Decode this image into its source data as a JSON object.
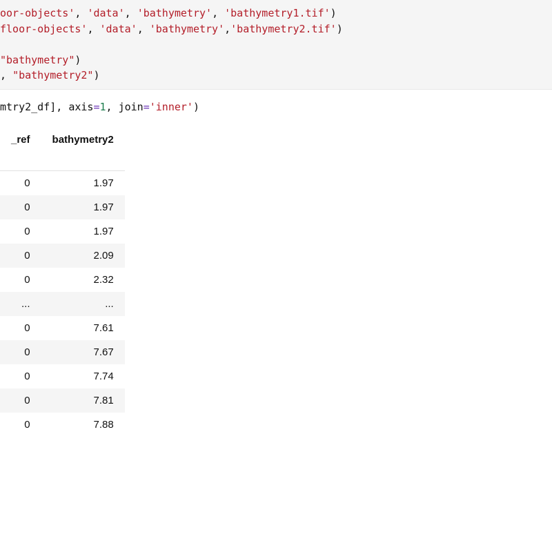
{
  "code1": {
    "line1": {
      "t1": "oor-objects'",
      "t2": ", ",
      "t3": "'data'",
      "t4": ", ",
      "t5": "'bathymetry'",
      "t6": ", ",
      "t7": "'bathymetry1.tif'",
      "t8": ")"
    },
    "line2": {
      "t1": "floor-objects'",
      "t2": ", ",
      "t3": "'data'",
      "t4": ", ",
      "t5": "'bathymetry'",
      "t6": ",",
      "t7": "'bathymetry2.tif'",
      "t8": ")"
    },
    "line3": {
      "t1": "\"bathymetry\"",
      "t2": ")"
    },
    "line4": {
      "t1": ", ",
      "t2": "\"bathymetry2\"",
      "t3": ")"
    }
  },
  "code2": {
    "t1": "mtry2_df], axis",
    "t2": "=",
    "t3": "1",
    "t4": ", join",
    "t5": "=",
    "t6": "'inner'",
    "t7": ")"
  },
  "table": {
    "headers": [
      "_ref",
      "bathymetry2"
    ],
    "rows": [
      [
        "0",
        "1.97"
      ],
      [
        "0",
        "1.97"
      ],
      [
        "0",
        "1.97"
      ],
      [
        "0",
        "2.09"
      ],
      [
        "0",
        "2.32"
      ],
      [
        "...",
        "..."
      ],
      [
        "0",
        "7.61"
      ],
      [
        "0",
        "7.67"
      ],
      [
        "0",
        "7.74"
      ],
      [
        "0",
        "7.81"
      ],
      [
        "0",
        "7.88"
      ]
    ]
  }
}
